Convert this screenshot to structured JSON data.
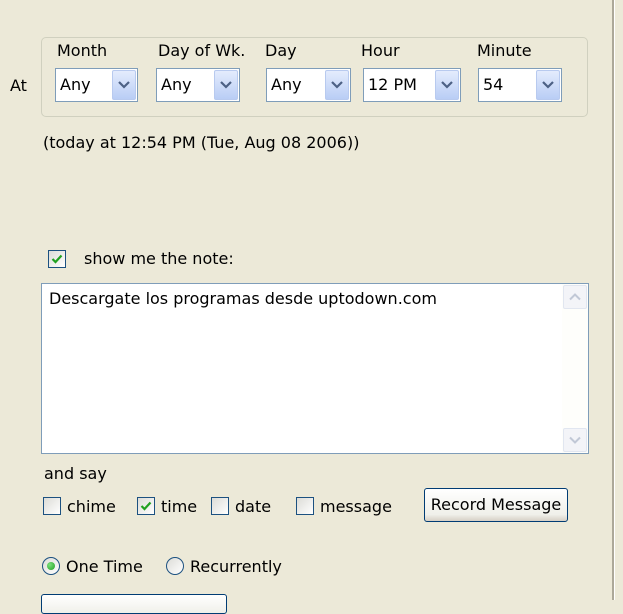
{
  "schedule": {
    "at_label": "At",
    "fields": [
      {
        "label": "Month",
        "value": "Any"
      },
      {
        "label": "Day of Wk.",
        "value": "Any"
      },
      {
        "label": "Day",
        "value": "Any"
      },
      {
        "label": "Hour",
        "value": "12 PM"
      },
      {
        "label": "Minute",
        "value": "54"
      }
    ],
    "summary": "(today at 12:54 PM (Tue, Aug 08 2006))"
  },
  "note": {
    "show_label": "show me the note:",
    "show_checked": true,
    "text": "Descargate los programas desde uptodown.com"
  },
  "say": {
    "label": "and say",
    "options": [
      {
        "label": "chime",
        "checked": false
      },
      {
        "label": "time",
        "checked": true
      },
      {
        "label": "date",
        "checked": false
      },
      {
        "label": "message",
        "checked": false
      }
    ],
    "record_button": "Record Message"
  },
  "frequency": {
    "options": [
      {
        "label": "One Time",
        "selected": true
      },
      {
        "label": "Recurrently",
        "selected": false
      }
    ]
  },
  "icons": {
    "dropdown": "chevron-down-icon",
    "check": "checkmark-icon",
    "scroll_up": "arrow-up-icon",
    "scroll_down": "arrow-down-icon"
  },
  "colors": {
    "window_bg": "#ECE9D8",
    "field_border": "#7F9DB9",
    "check_green": "#21A121"
  }
}
